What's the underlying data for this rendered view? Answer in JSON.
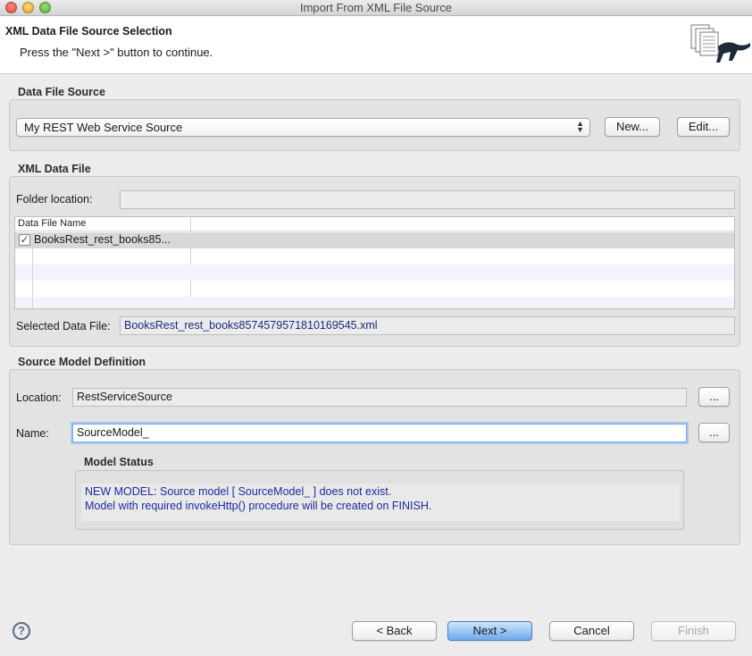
{
  "window": {
    "title": "Import From XML File Source"
  },
  "header": {
    "title": "XML Data File Source Selection",
    "subtitle": "Press the \"Next >\" button to continue."
  },
  "data_file_source": {
    "section_label": "Data File Source",
    "selected_source": "My REST Web Service Source",
    "new_label": "New...",
    "edit_label": "Edit..."
  },
  "xml_data_file": {
    "section_label": "XML Data File",
    "folder_location_label": "Folder location:",
    "folder_location_value": "",
    "table": {
      "column_header": "Data File Name",
      "rows": [
        {
          "checked": true,
          "name": "BooksRest_rest_books85..."
        }
      ]
    },
    "selected_file_label": "Selected Data File:",
    "selected_file_value": "BooksRest_rest_books8574579571810169545.xml"
  },
  "source_model": {
    "section_label": "Source Model Definition",
    "location_label": "Location:",
    "location_value": "RestServiceSource",
    "name_label": "Name:",
    "name_value": "SourceModel_",
    "browse_label": "...",
    "status_title": "Model Status",
    "status_line1": "NEW MODEL: Source model [ SourceModel_ ] does not exist.",
    "status_line2": "Model with required invokeHttp() procedure will be created on FINISH."
  },
  "footer": {
    "help_glyph": "?",
    "back_label": "< Back",
    "next_label": "Next >",
    "cancel_label": "Cancel",
    "finish_label": "Finish"
  }
}
